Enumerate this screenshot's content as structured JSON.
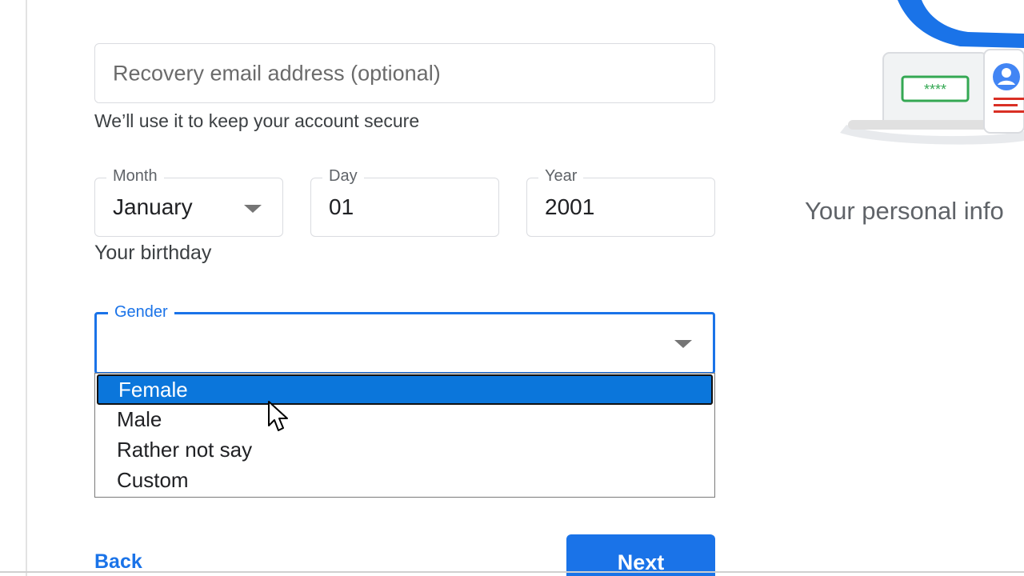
{
  "recovery": {
    "placeholder": "Recovery email address (optional)",
    "helper": "We’ll use it to keep your account secure"
  },
  "birthday": {
    "month_label": "Month",
    "month_value": "January",
    "day_label": "Day",
    "day_value": "01",
    "year_label": "Year",
    "year_value": "2001",
    "helper": "Your birthday"
  },
  "gender": {
    "label": "Gender",
    "value": "",
    "options": [
      "Female",
      "Male",
      "Rather not say",
      "Custom"
    ],
    "highlighted": "Female"
  },
  "footer": {
    "back_label": "Back",
    "next_label": "Next"
  },
  "side_panel": {
    "text": "Your personal info",
    "password_mask": "****"
  },
  "colors": {
    "accent": "#1a73e8",
    "highlight": "#0b76db",
    "illustration_accent": "#d93025",
    "illustration_green": "#34a853"
  },
  "icons": {
    "dropdown": "chevron-down-icon",
    "cursor": "mouse-pointer-icon",
    "illustration": "laptop-security-illustration"
  }
}
